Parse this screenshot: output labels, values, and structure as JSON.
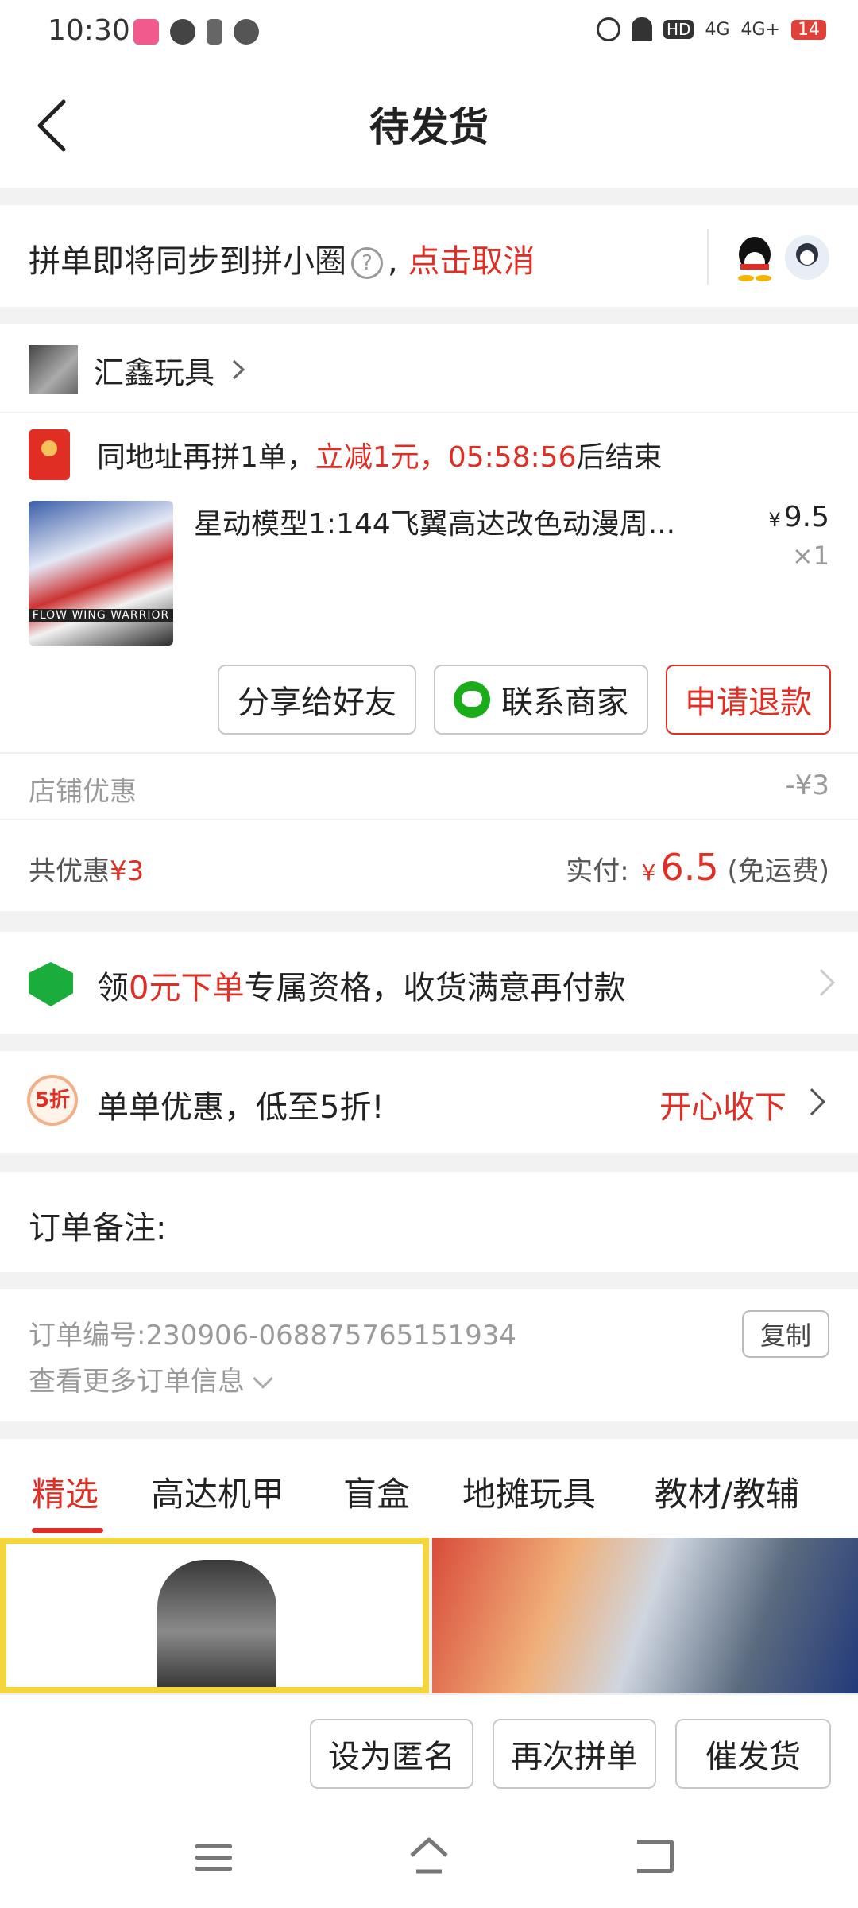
{
  "status_bar": {
    "time": "10:30",
    "network_1": "4G",
    "network_2": "4G+",
    "battery": "14"
  },
  "header": {
    "title": "待发货"
  },
  "sync_banner": {
    "text": "拼单即将同步到拼小圈",
    "help_icon_text": "?",
    "separator": ",",
    "cancel_link": "点击取消"
  },
  "shop": {
    "name": "汇鑫玩具"
  },
  "promo": {
    "prefix": "同地址再拼1单，",
    "highlight": "立减1元，05:58:56",
    "suffix": "后结束"
  },
  "product": {
    "image_caption": "FLOW WING WARRIOR",
    "name": "星动模型1:144飞翼高达改色动漫周...",
    "currency": "¥",
    "price": "9.5",
    "quantity": "×1"
  },
  "actions": {
    "share": "分享给好友",
    "contact": "联系商家",
    "refund": "申请退款"
  },
  "discount": {
    "label": "店铺优惠",
    "value": "-¥3"
  },
  "total": {
    "label": "共优惠",
    "value": "¥3",
    "paid_label": "实付:",
    "currency": "¥",
    "paid_amount": "6.5",
    "shipping": "(免运费)"
  },
  "zero_order": {
    "pre": "领",
    "highlight": "0元下单",
    "post": "专属资格，收货满意再付款"
  },
  "coupon": {
    "badge": "5折",
    "text": "单单优惠，低至5折!",
    "action": "开心收下"
  },
  "note": {
    "label": "订单备注:"
  },
  "order_info": {
    "number_label": "订单编号:",
    "number": "230906-068875765151934",
    "copy_button": "复制",
    "more": "查看更多订单信息"
  },
  "tabs": [
    "精选",
    "高达机甲",
    "盲盒",
    "地摊玩具",
    "教材/教辅"
  ],
  "bottom_actions": {
    "anonymous": "设为匿名",
    "rebuy": "再次拼单",
    "urge": "催发货"
  },
  "colors": {
    "accent": "#e02e24",
    "wechat": "#1aad19",
    "background": "#f2f2f2"
  }
}
